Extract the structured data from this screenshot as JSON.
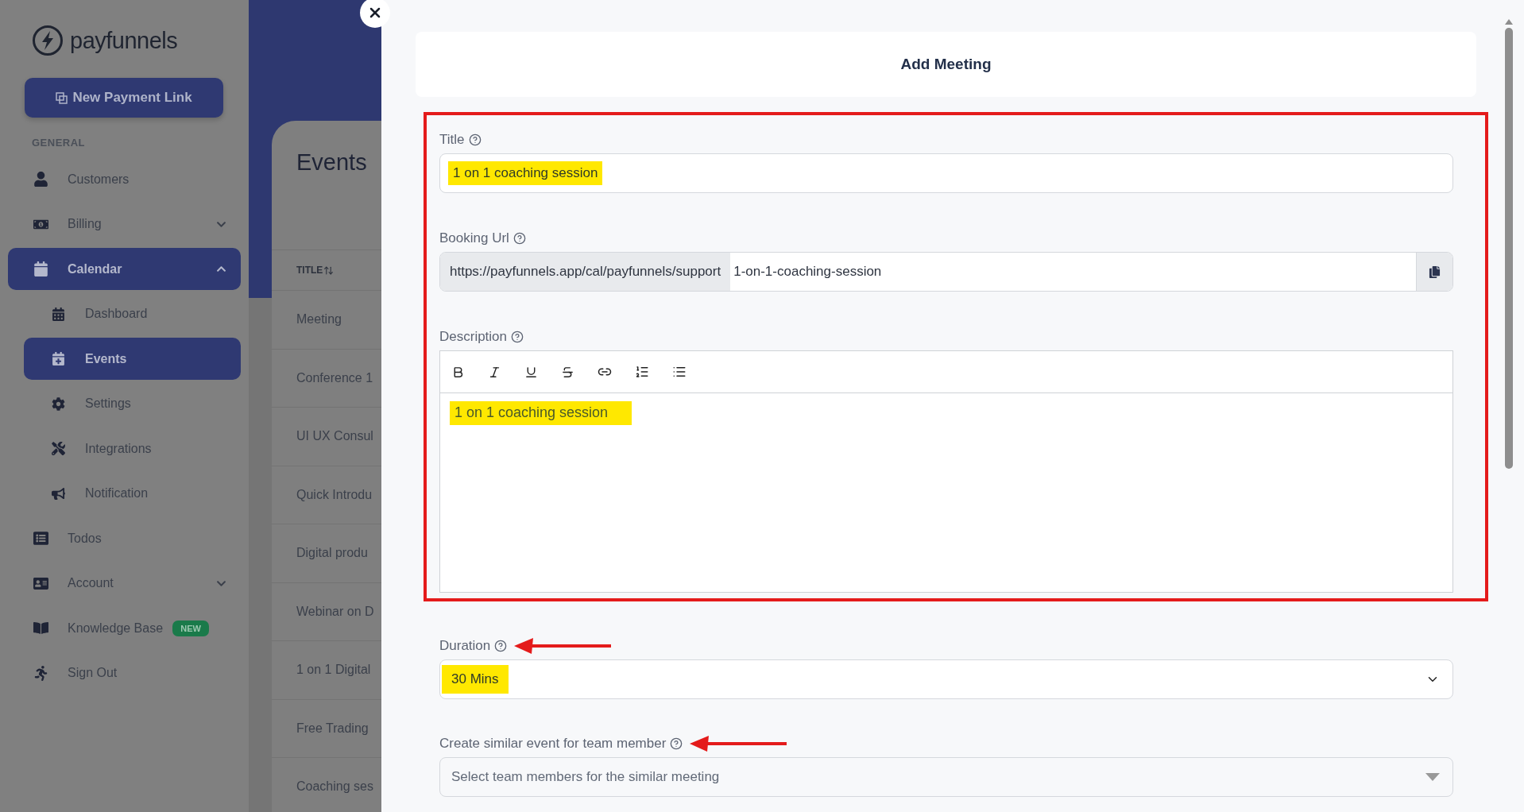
{
  "sidebar": {
    "brand": "payfunnels",
    "new_button": "New Payment Link",
    "section": "GENERAL",
    "items": [
      {
        "label": "Customers",
        "selected": false
      },
      {
        "label": "Billing",
        "selected": false,
        "expanded": false
      },
      {
        "label": "Calendar",
        "selected": true,
        "expanded": true,
        "children": [
          {
            "label": "Dashboard",
            "selected": false
          },
          {
            "label": "Events",
            "selected": true
          },
          {
            "label": "Settings",
            "selected": false
          },
          {
            "label": "Integrations",
            "selected": false
          },
          {
            "label": "Notification",
            "selected": false
          }
        ]
      },
      {
        "label": "Todos",
        "selected": false
      },
      {
        "label": "Account",
        "selected": false,
        "expanded": false
      },
      {
        "label": "Knowledge Base",
        "selected": false,
        "badge": "NEW"
      },
      {
        "label": "Sign Out",
        "selected": false
      }
    ]
  },
  "events_page": {
    "title": "Events",
    "column": "TITLE",
    "rows": [
      "Meeting",
      "Conference 1",
      "UI UX Consul",
      "Quick Introdu",
      "Digital produ",
      "Webinar on D",
      "1 on 1 Digital",
      "Free Trading",
      "Coaching ses"
    ]
  },
  "drawer": {
    "title": "Add Meeting",
    "framed_fields": [
      {
        "kind": "text",
        "label": "Title",
        "value": "1 on 1 coaching session",
        "highlighted": true,
        "arrow": false
      },
      {
        "kind": "url",
        "label": "Booking Url",
        "prefix": "https://payfunnels.app/cal/payfunnels/support",
        "value": "1-on-1-coaching-session",
        "highlighted": false,
        "arrow": false
      },
      {
        "kind": "editor",
        "label": "Description",
        "value": "1 on 1 coaching session",
        "highlighted": true,
        "arrow": false
      }
    ],
    "fields": [
      {
        "kind": "select",
        "label": "Duration",
        "value": "30 Mins",
        "highlighted": true,
        "arrow": true
      },
      {
        "kind": "multiselect",
        "label": "Create similar event for team member",
        "placeholder": "Select team members for the similar meeting",
        "highlighted": false,
        "arrow": true
      }
    ]
  }
}
